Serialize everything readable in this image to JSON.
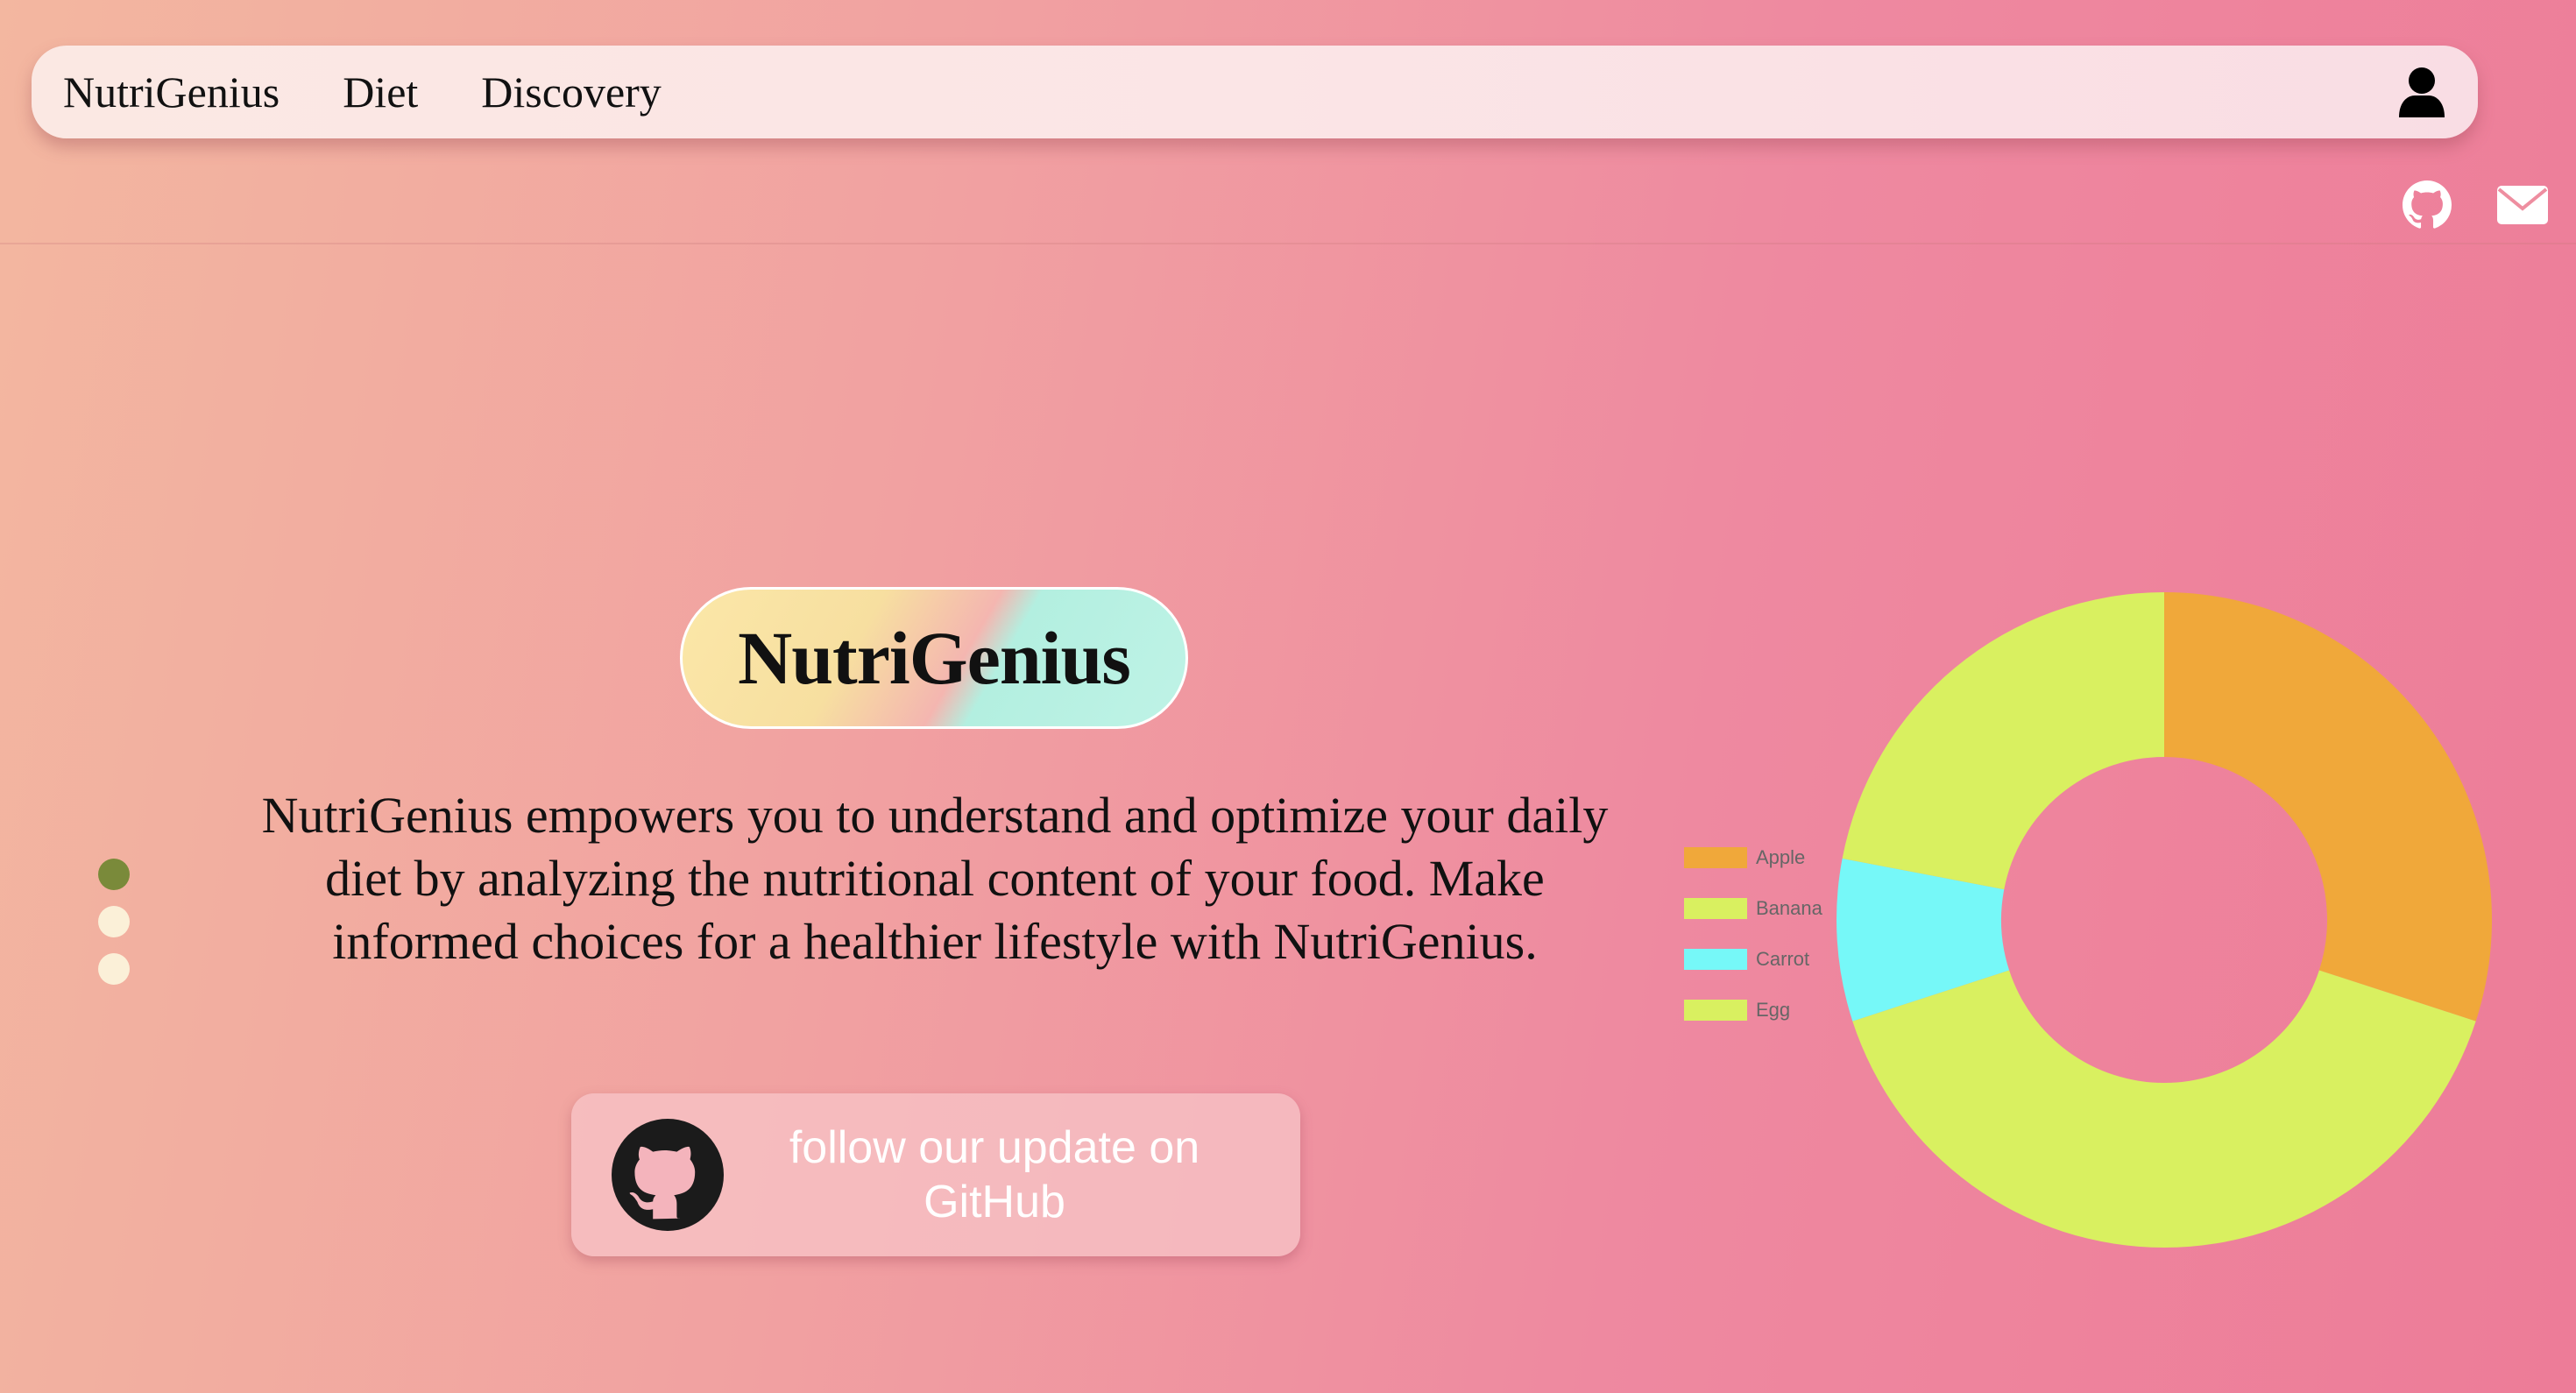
{
  "nav": {
    "brand": "NutriGenius",
    "links": [
      "Diet",
      "Discovery"
    ],
    "user_icon": "user-icon"
  },
  "social": {
    "icons": [
      "github-icon",
      "mail-icon"
    ]
  },
  "slider": {
    "dot_count": 3,
    "active_index": 0,
    "active_color": "#7a8a3a",
    "inactive_color": "#fbf0d8"
  },
  "hero": {
    "title": "NutriGenius",
    "tagline": "NutriGenius empowers you to understand and optimize your daily diet by analyzing the nutritional content of your food. Make informed choices for a healthier lifestyle with NutriGenius.",
    "github_button": "follow our update on GitHub",
    "github_icon": "github-icon"
  },
  "chart_data": {
    "type": "doughnut",
    "title": "",
    "legend_position": "left",
    "categories": [
      "Apple",
      "Banana",
      "Carrot",
      "Egg"
    ],
    "values": [
      30,
      40,
      8,
      22
    ],
    "colors": [
      "#f0a83a",
      "#d9f060",
      "#76f8f8",
      "#d9f060"
    ]
  }
}
